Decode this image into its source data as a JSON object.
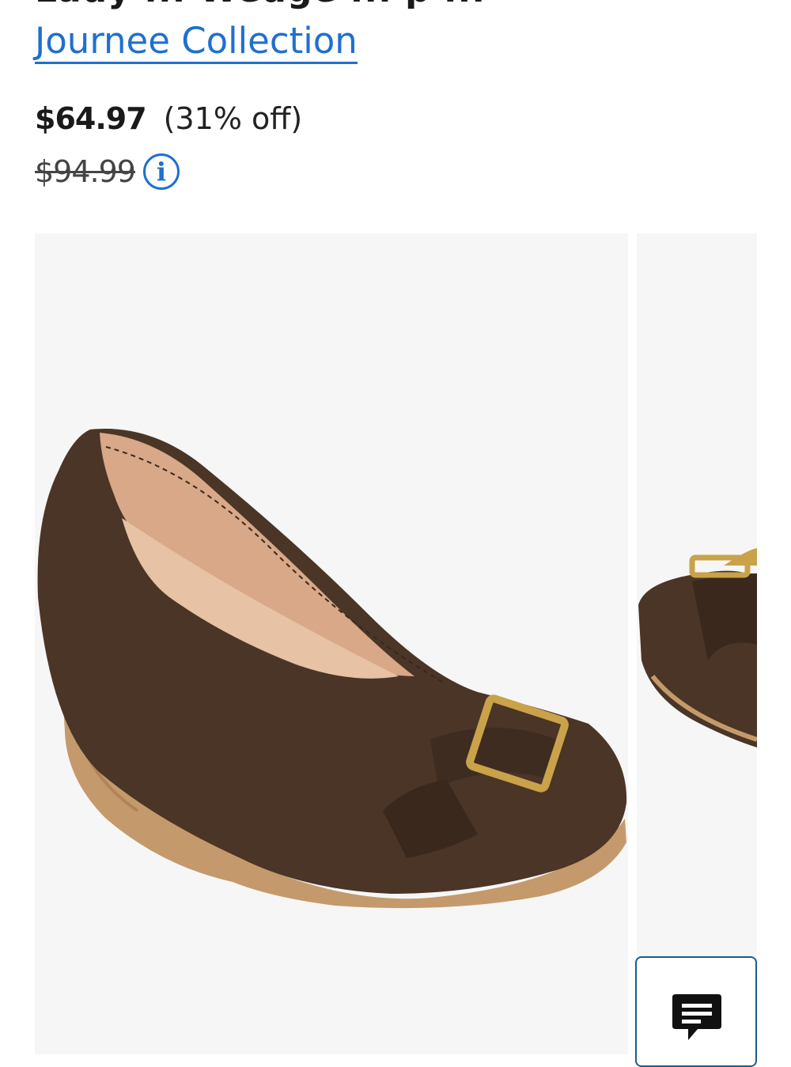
{
  "product": {
    "title_fragment": "Lady ... Wedge ... p ...",
    "brand": "Journee Collection",
    "price": "$64.97",
    "discount": "(31% off)",
    "original_price": "$94.99"
  },
  "icons": {
    "info": "info-circle-icon",
    "chat": "chat-bubble-icon"
  },
  "colors": {
    "link": "#1f6fd1",
    "shoe": "#4a3527",
    "wedge": "#c49a6c",
    "buckle": "#c9a24a",
    "chat_border": "#1b5c8a"
  }
}
